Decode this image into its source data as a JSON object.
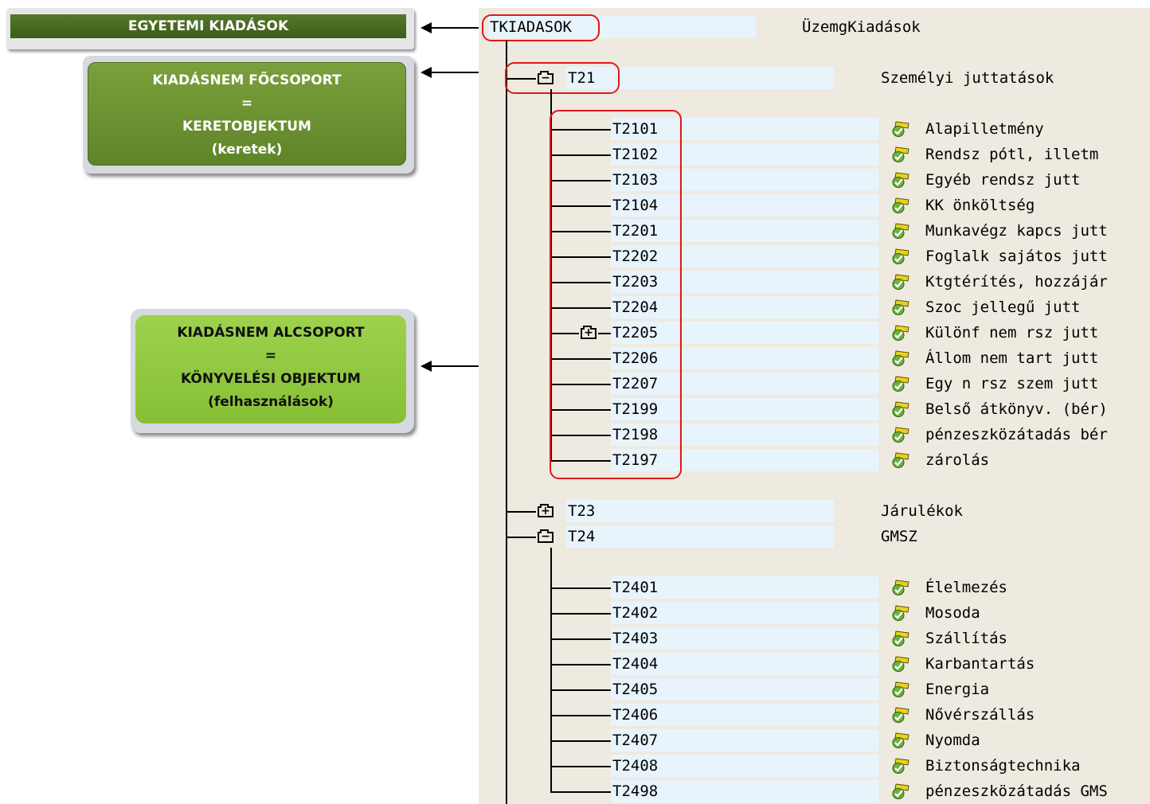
{
  "callouts": {
    "top": "EGYETEMI KIADÁSOK",
    "mid": [
      "KIADÁSNEM FŐCSOPORT",
      "=",
      "KERETOBJEKTUM",
      "(keretek)"
    ],
    "low": [
      "KIADÁSNEM ALCSOPORT",
      "=",
      "KÖNYVELÉSI OBJEKTUM",
      "(felhasználások)"
    ]
  },
  "tree": {
    "root": {
      "code": "TKIADASOK",
      "desc": "ÜzemgKiadások"
    },
    "groups": [
      {
        "code": "T21",
        "desc": "Személyi juttatások",
        "state": "expanded",
        "children": [
          {
            "code": "T2101",
            "desc": "Alapilletmény"
          },
          {
            "code": "T2102",
            "desc": "Rendsz pótl, illetm"
          },
          {
            "code": "T2103",
            "desc": "Egyéb rendsz jutt"
          },
          {
            "code": "T2104",
            "desc": "KK önköltség"
          },
          {
            "code": "T2201",
            "desc": "Munkavégz kapcs jutt"
          },
          {
            "code": "T2202",
            "desc": "Foglalk sajátos jutt"
          },
          {
            "code": "T2203",
            "desc": "Ktgtérítés, hozzájár"
          },
          {
            "code": "T2204",
            "desc": "Szoc jellegű jutt"
          },
          {
            "code": "T2205",
            "desc": "Különf nem rsz jutt",
            "state": "collapsed"
          },
          {
            "code": "T2206",
            "desc": "Állom nem tart jutt"
          },
          {
            "code": "T2207",
            "desc": "Egy n rsz szem jutt"
          },
          {
            "code": "T2199",
            "desc": "Belső átkönyv. (bér)"
          },
          {
            "code": "T2198",
            "desc": "pénzeszközátadás bér"
          },
          {
            "code": "T2197",
            "desc": "zárolás"
          }
        ]
      },
      {
        "code": "T23",
        "desc": "Járulékok",
        "state": "collapsed",
        "children": []
      },
      {
        "code": "T24",
        "desc": "GMSZ",
        "state": "expanded",
        "children": [
          {
            "code": "T2401",
            "desc": "Élelmezés"
          },
          {
            "code": "T2402",
            "desc": "Mosoda"
          },
          {
            "code": "T2403",
            "desc": "Szállítás"
          },
          {
            "code": "T2404",
            "desc": "Karbantartás"
          },
          {
            "code": "T2405",
            "desc": "Energia"
          },
          {
            "code": "T2406",
            "desc": "Nővérszállás"
          },
          {
            "code": "T2407",
            "desc": "Nyomda"
          },
          {
            "code": "T2408",
            "desc": "Biztonságtechnika"
          },
          {
            "code": "T2498",
            "desc": "pénzeszközátadás GMS"
          }
        ]
      }
    ]
  },
  "icons": {
    "leaf": "posting-object-check-icon",
    "expanded": "folder-minus-icon",
    "collapsed": "folder-plus-icon"
  },
  "colors": {
    "panel_bg": "#eeeae0",
    "code_field_bg": "#e8f4fc",
    "highlight": "#e01818",
    "dark_green": "#3e5c1a",
    "mid_green": "#6a8f30",
    "light_green": "#8fc63e"
  }
}
